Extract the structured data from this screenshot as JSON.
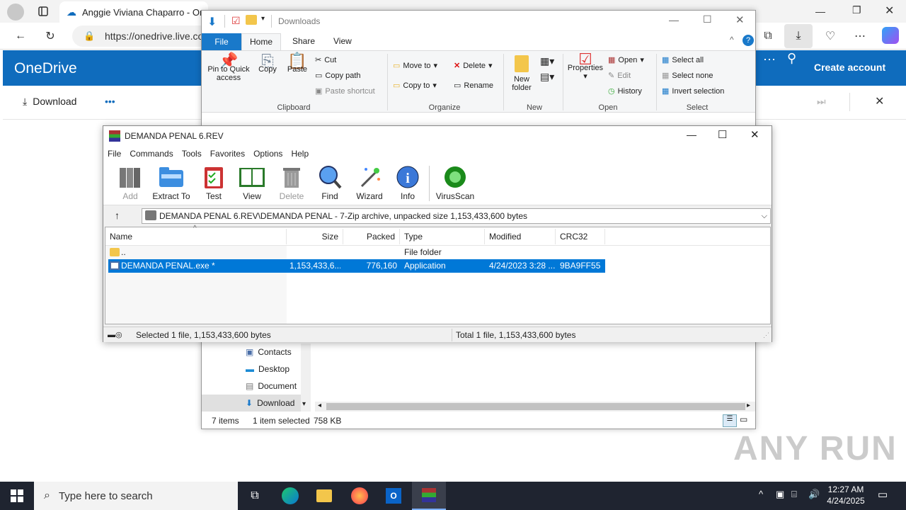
{
  "browser": {
    "tab_title": "Anggie Viviana Chaparro - OneDrive",
    "url": "https://onedrive.live.com"
  },
  "onedrive": {
    "app_title": "OneDrive",
    "create_account": "Create account",
    "download_label": "Download",
    "more_label": "•••"
  },
  "explorer": {
    "title": "Downloads",
    "tabs": [
      "File",
      "Home",
      "Share",
      "View"
    ],
    "clipboard": {
      "pin": "Pin to Quick access",
      "copy": "Copy",
      "paste": "Paste",
      "cut": "Cut",
      "copy_path": "Copy path",
      "paste_shortcut": "Paste shortcut",
      "group": "Clipboard"
    },
    "organize": {
      "move_to": "Move to",
      "copy_to": "Copy to",
      "delete": "Delete",
      "rename": "Rename",
      "group": "Organize"
    },
    "new": {
      "new_folder": "New folder",
      "group": "New"
    },
    "open": {
      "properties": "Properties",
      "open": "Open",
      "edit": "Edit",
      "history": "History",
      "group": "Open"
    },
    "select": {
      "select_all": "Select all",
      "select_none": "Select none",
      "invert": "Invert selection",
      "group": "Select"
    },
    "nav_items": [
      "Contacts",
      "Desktop",
      "Document",
      "Download"
    ],
    "status": {
      "items": "7 items",
      "selected": "1 item selected",
      "size": "758 KB"
    }
  },
  "winrar": {
    "title": "DEMANDA PENAL 6.REV",
    "menu": [
      "File",
      "Commands",
      "Tools",
      "Favorites",
      "Options",
      "Help"
    ],
    "toolbar": [
      "Add",
      "Extract To",
      "Test",
      "View",
      "Delete",
      "Find",
      "Wizard",
      "Info",
      "VirusScan"
    ],
    "path": "DEMANDA PENAL 6.REV\\DEMANDA PENAL - 7-Zip archive, unpacked size 1,153,433,600 bytes",
    "columns": [
      "Name",
      "Size",
      "Packed",
      "Type",
      "Modified",
      "CRC32"
    ],
    "rows": [
      {
        "name": "..",
        "size": "",
        "packed": "",
        "type": "File folder",
        "modified": "",
        "crc": ""
      },
      {
        "name": "DEMANDA PENAL.exe *",
        "size": "1,153,433,6...",
        "packed": "776,160",
        "type": "Application",
        "modified": "4/24/2023 3:28 ...",
        "crc": "9BA9FF55"
      }
    ],
    "status_left": "Selected 1 file, 1,153,433,600 bytes",
    "status_right": "Total 1 file, 1,153,433,600 bytes"
  },
  "taskbar": {
    "search_placeholder": "Type here to search",
    "time": "12:27 AM",
    "date": "4/24/2025"
  },
  "watermark": "ANY RUN"
}
